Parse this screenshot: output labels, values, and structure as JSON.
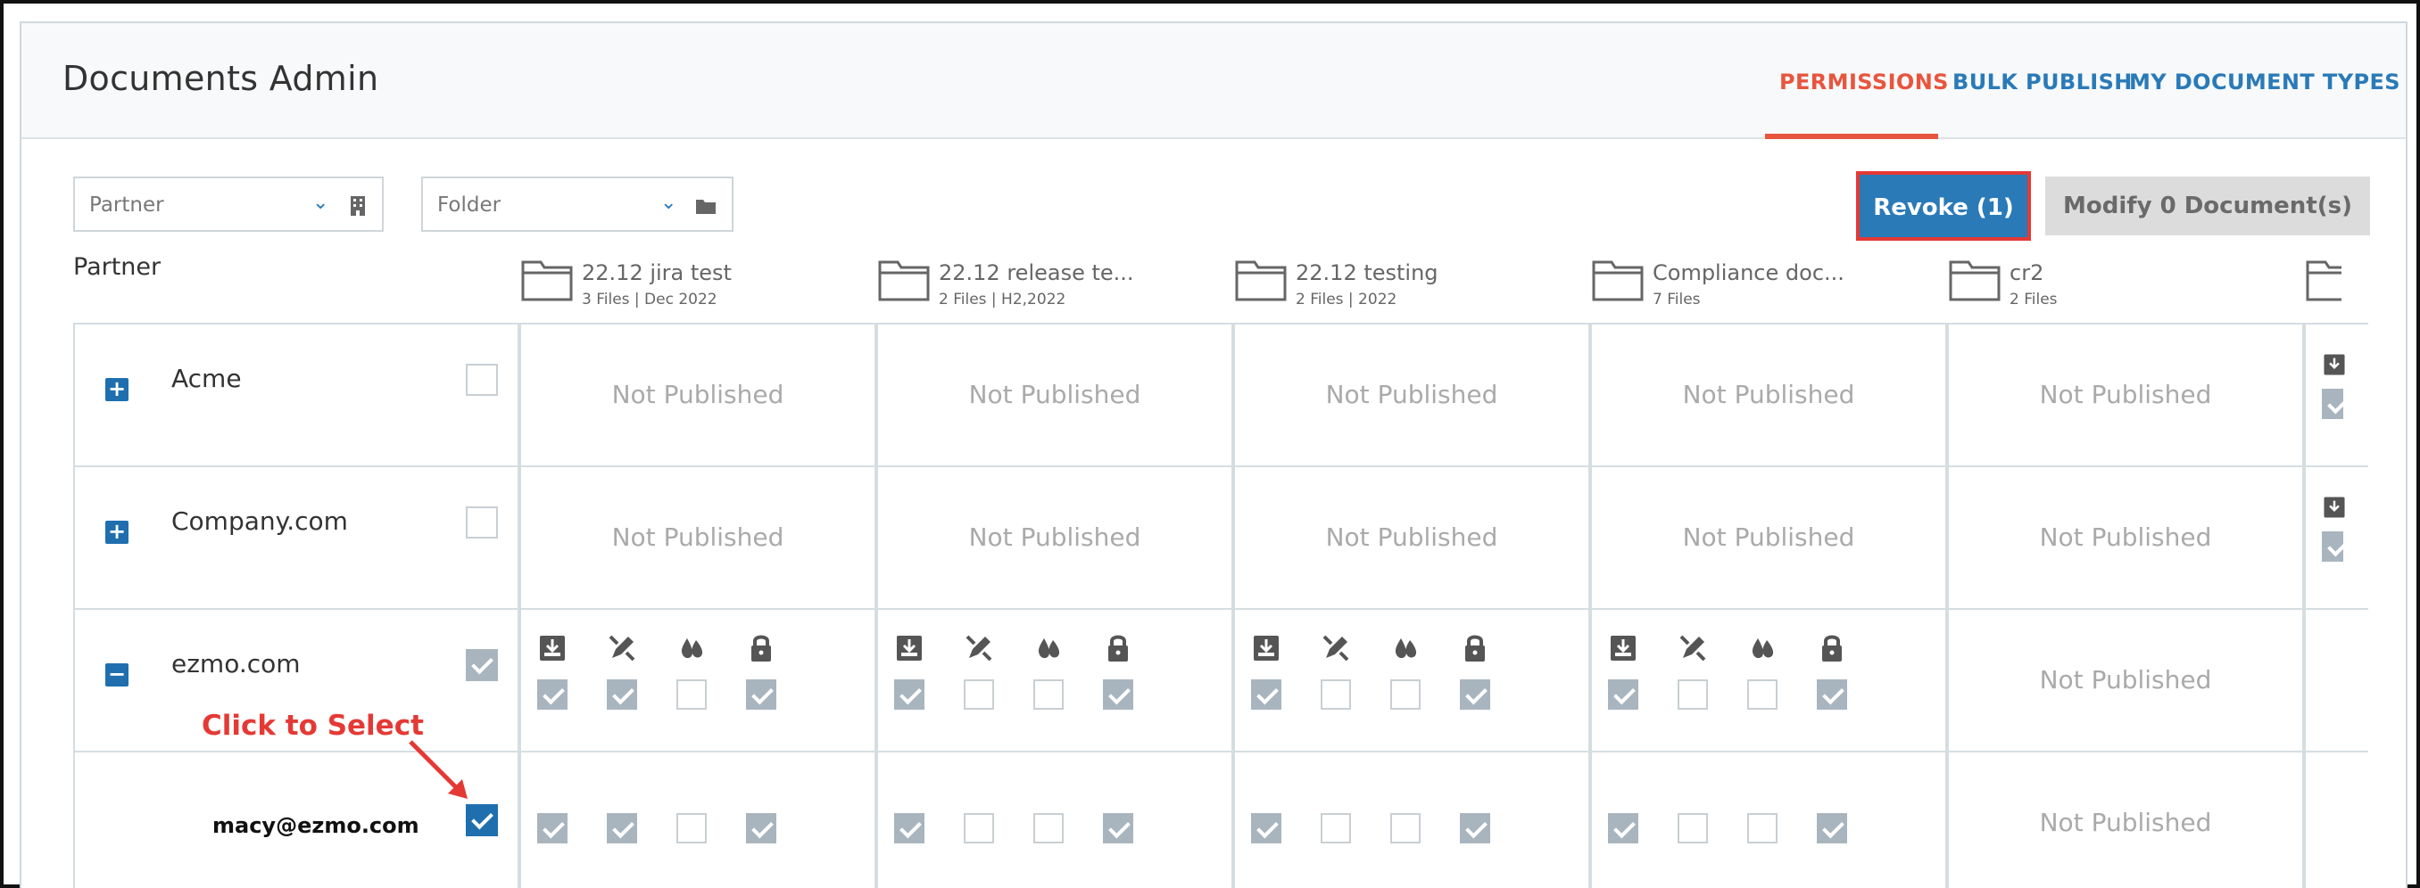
{
  "app": {
    "title": "Documents Admin"
  },
  "nav": {
    "tabs": [
      {
        "label": "PERMISSIONS",
        "active": true
      },
      {
        "label": "BULK PUBLISH",
        "active": false
      },
      {
        "label": "MY DOCUMENT TYPES",
        "active": false
      }
    ]
  },
  "filters": {
    "partner": {
      "placeholder": "Partner",
      "icon": "building-icon"
    },
    "folder": {
      "placeholder": "Folder",
      "icon": "folder-icon"
    }
  },
  "actions": {
    "revoke_label": "Revoke (1)",
    "modify_label": "Modify 0 Document(s)"
  },
  "table": {
    "partner_header": "Partner",
    "folders": [
      {
        "name": "22.12 jira test",
        "meta": "3 Files | Dec 2022"
      },
      {
        "name": "22.12 release te...",
        "meta": "2 Files | H2,2022"
      },
      {
        "name": "22.12 testing",
        "meta": "2 Files | 2022"
      },
      {
        "name": "Compliance doc...",
        "meta": "7 Files"
      },
      {
        "name": "cr2",
        "meta": "2 Files"
      }
    ],
    "not_published": "Not Published",
    "permission_icons": [
      "download-icon",
      "edit-icon",
      "watermark-icon",
      "lock-icon"
    ],
    "rows": [
      {
        "name": "Acme",
        "expanded": false,
        "checked": false
      },
      {
        "name": "Company.com",
        "expanded": false,
        "checked": false
      },
      {
        "name": "ezmo.com",
        "expanded": true,
        "checked": true
      },
      {
        "name": "macy@ezmo.com",
        "checked": true
      }
    ],
    "ezmo_permissions": [
      [
        true,
        true,
        false,
        true
      ],
      [
        true,
        false,
        false,
        true
      ],
      [
        true,
        false,
        false,
        true
      ],
      [
        true,
        false,
        false,
        true
      ]
    ],
    "macy_permissions": [
      [
        true,
        true,
        false,
        true
      ],
      [
        true,
        false,
        false,
        true
      ],
      [
        true,
        false,
        false,
        true
      ],
      [
        true,
        false,
        false,
        true
      ]
    ]
  },
  "annotation": {
    "text": "Click to Select",
    "color": "#e53935"
  },
  "colors": {
    "accent": "#2a7ab8",
    "active_tab": "#e8553e",
    "annotation": "#e53935"
  }
}
